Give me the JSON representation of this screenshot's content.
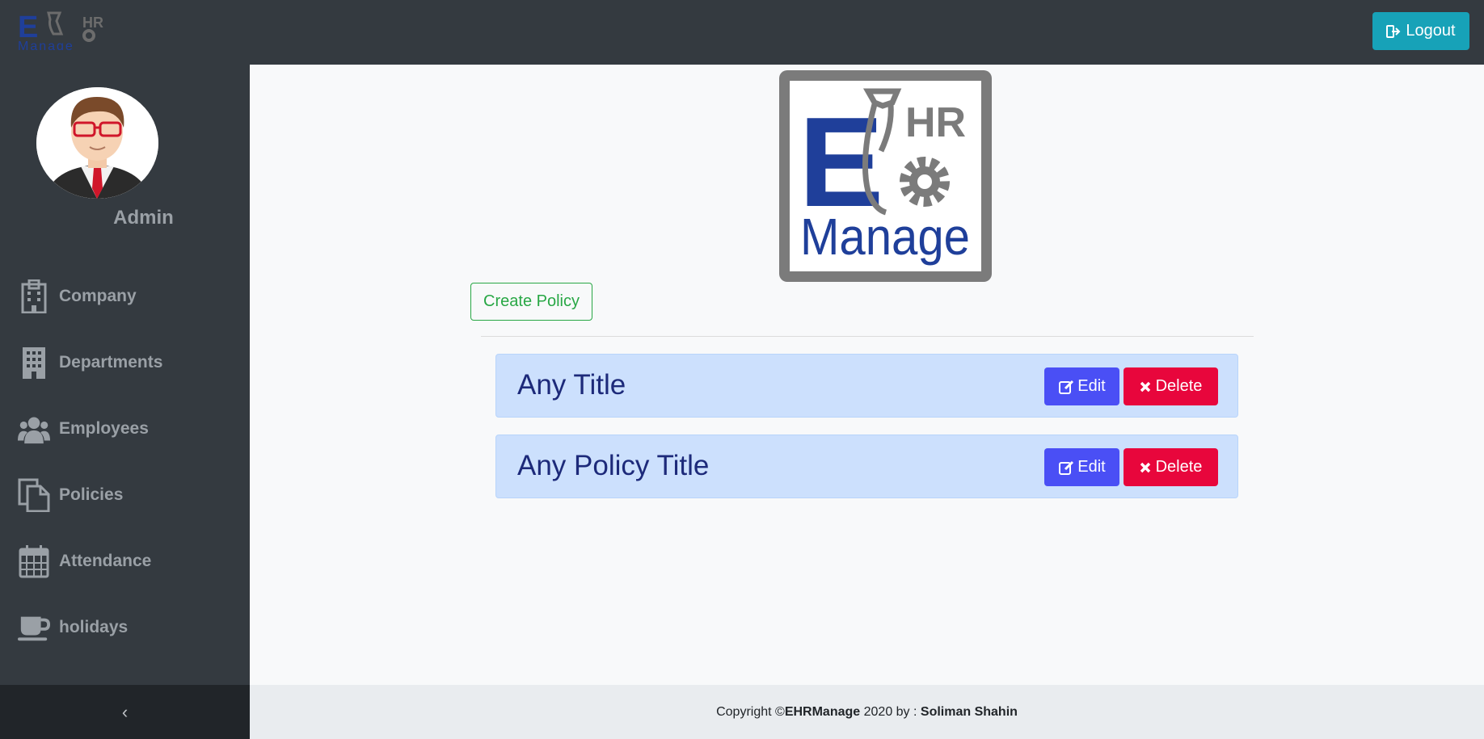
{
  "header": {
    "logo_text": "EHR Manage",
    "logout_label": "Logout",
    "logout_icon": "sign-out-icon",
    "colors": {
      "bar": "#343a40",
      "logout": "#17a2b8"
    }
  },
  "sidebar": {
    "user_name": "Admin",
    "items": [
      {
        "label": "Company",
        "icon": "building-icon"
      },
      {
        "label": "Departments",
        "icon": "office-building-icon"
      },
      {
        "label": "Employees",
        "icon": "users-icon"
      },
      {
        "label": "Policies",
        "icon": "files-icon"
      },
      {
        "label": "Attendance",
        "icon": "calendar-icon"
      },
      {
        "label": "holidays",
        "icon": "coffee-icon"
      }
    ],
    "collapse_glyph": "‹"
  },
  "main": {
    "create_label": "Create Policy",
    "policies": [
      {
        "title": "Any Title"
      },
      {
        "title": "Any Policy Title"
      }
    ],
    "edit_label": "Edit",
    "delete_label": "Delete",
    "colors": {
      "card": "#cce0fd",
      "edit": "#4a4ff5",
      "delete": "#e8063c",
      "create": "#28a745"
    }
  },
  "footer": {
    "prefix": "Copyright © ",
    "brand": "EHRManage",
    "middle": " 2020 by : ",
    "author": "Soliman Shahin"
  }
}
